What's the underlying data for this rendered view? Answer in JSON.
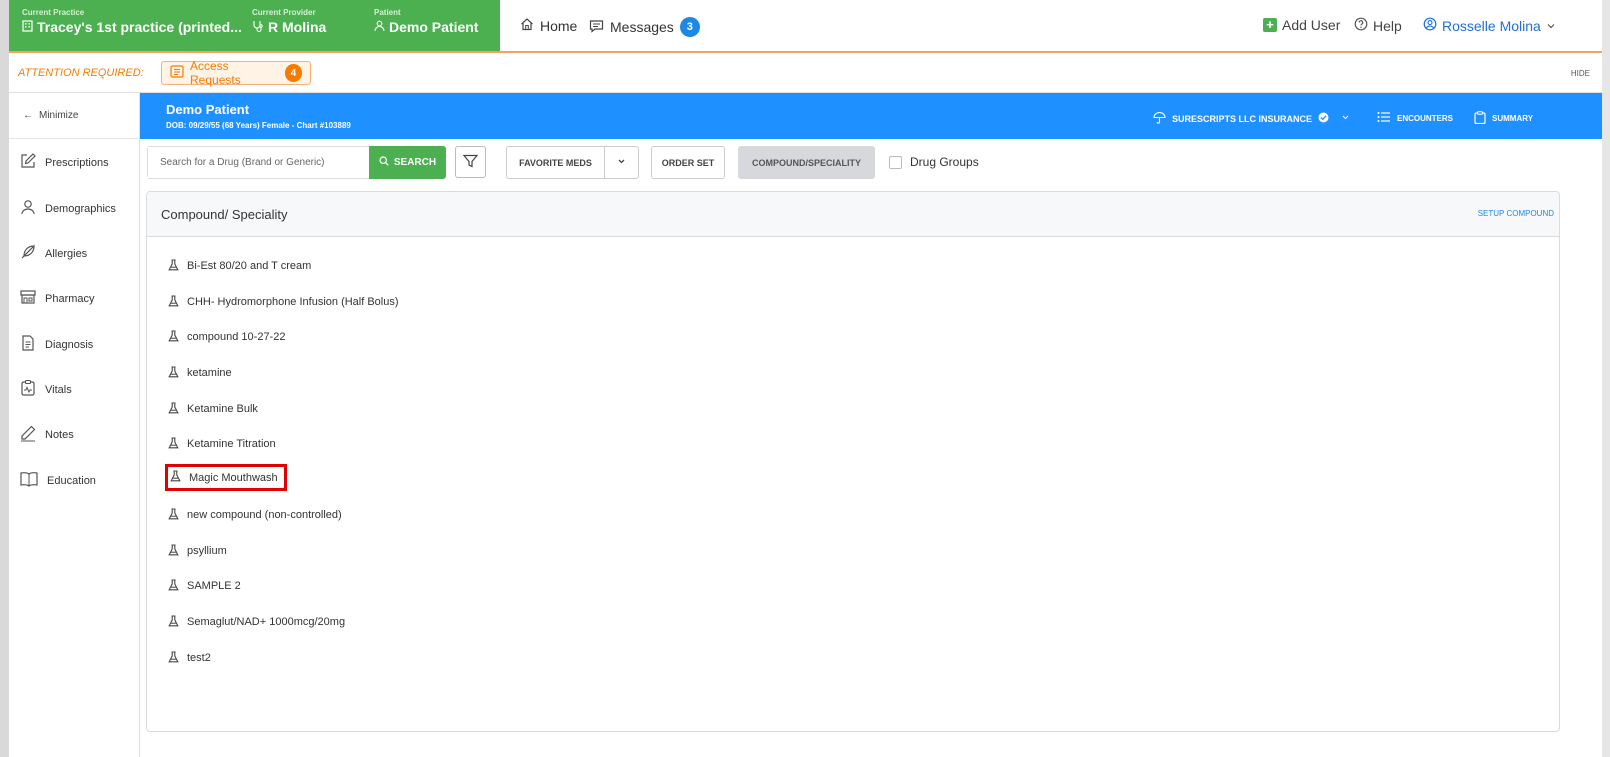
{
  "context": {
    "practice_label": "Current Practice",
    "practice_value": "Tracey's 1st practice (printed...",
    "provider_label": "Current Provider",
    "provider_value": "R Molina",
    "patient_label": "Patient",
    "patient_value": "Demo Patient"
  },
  "nav": {
    "home": "Home",
    "messages": "Messages",
    "messages_count": "3",
    "add_user": "Add User",
    "help": "Help",
    "user_name": "Rosselle Molina"
  },
  "attention": {
    "label": "ATTENTION REQUIRED:",
    "access_requests": "Access Requests",
    "access_count": "4",
    "hide": "HIDE"
  },
  "sidebar": {
    "minimize": "Minimize",
    "items": [
      {
        "label": "Prescriptions",
        "icon": "edit-icon"
      },
      {
        "label": "Demographics",
        "icon": "user-icon"
      },
      {
        "label": "Allergies",
        "icon": "feather-icon"
      },
      {
        "label": "Pharmacy",
        "icon": "store-icon"
      },
      {
        "label": "Diagnosis",
        "icon": "document-icon"
      },
      {
        "label": "Vitals",
        "icon": "vitals-icon"
      },
      {
        "label": "Notes",
        "icon": "pencil-icon"
      },
      {
        "label": "Education",
        "icon": "book-icon"
      }
    ]
  },
  "patient": {
    "name": "Demo Patient",
    "info": "DOB: 09/29/55 (68 Years) Female - Chart #103889",
    "insurance": "SURESCRIPTS LLC INSURANCE",
    "encounters": "ENCOUNTERS",
    "summary": "SUMMARY"
  },
  "toolbar": {
    "search_placeholder": "Search for a Drug (Brand or Generic)",
    "search_button": "SEARCH",
    "favorite_meds": "FAVORITE MEDS",
    "order_set": "ORDER SET",
    "compound_speciality": "COMPOUND/SPECIALITY",
    "drug_groups": "Drug Groups"
  },
  "panel": {
    "title": "Compound/ Speciality",
    "setup": "SETUP COMPOUND",
    "selected_index": 6,
    "items": [
      "Bi-Est 80/20 and T cream",
      "CHH- Hydromorphone Infusion (Half Bolus)",
      "compound 10-27-22",
      "ketamine",
      "Ketamine Bulk",
      "Ketamine Titration",
      "Magic Mouthwash",
      "new compound (non-controlled)",
      "psyllium",
      "SAMPLE 2",
      "Semaglut/NAD+ 1000mcg/20mg",
      "test2"
    ]
  },
  "colors": {
    "green": "#4caf50",
    "blue": "#1e90ff",
    "orange": "#f57c00",
    "selection_red": "#e00000"
  }
}
